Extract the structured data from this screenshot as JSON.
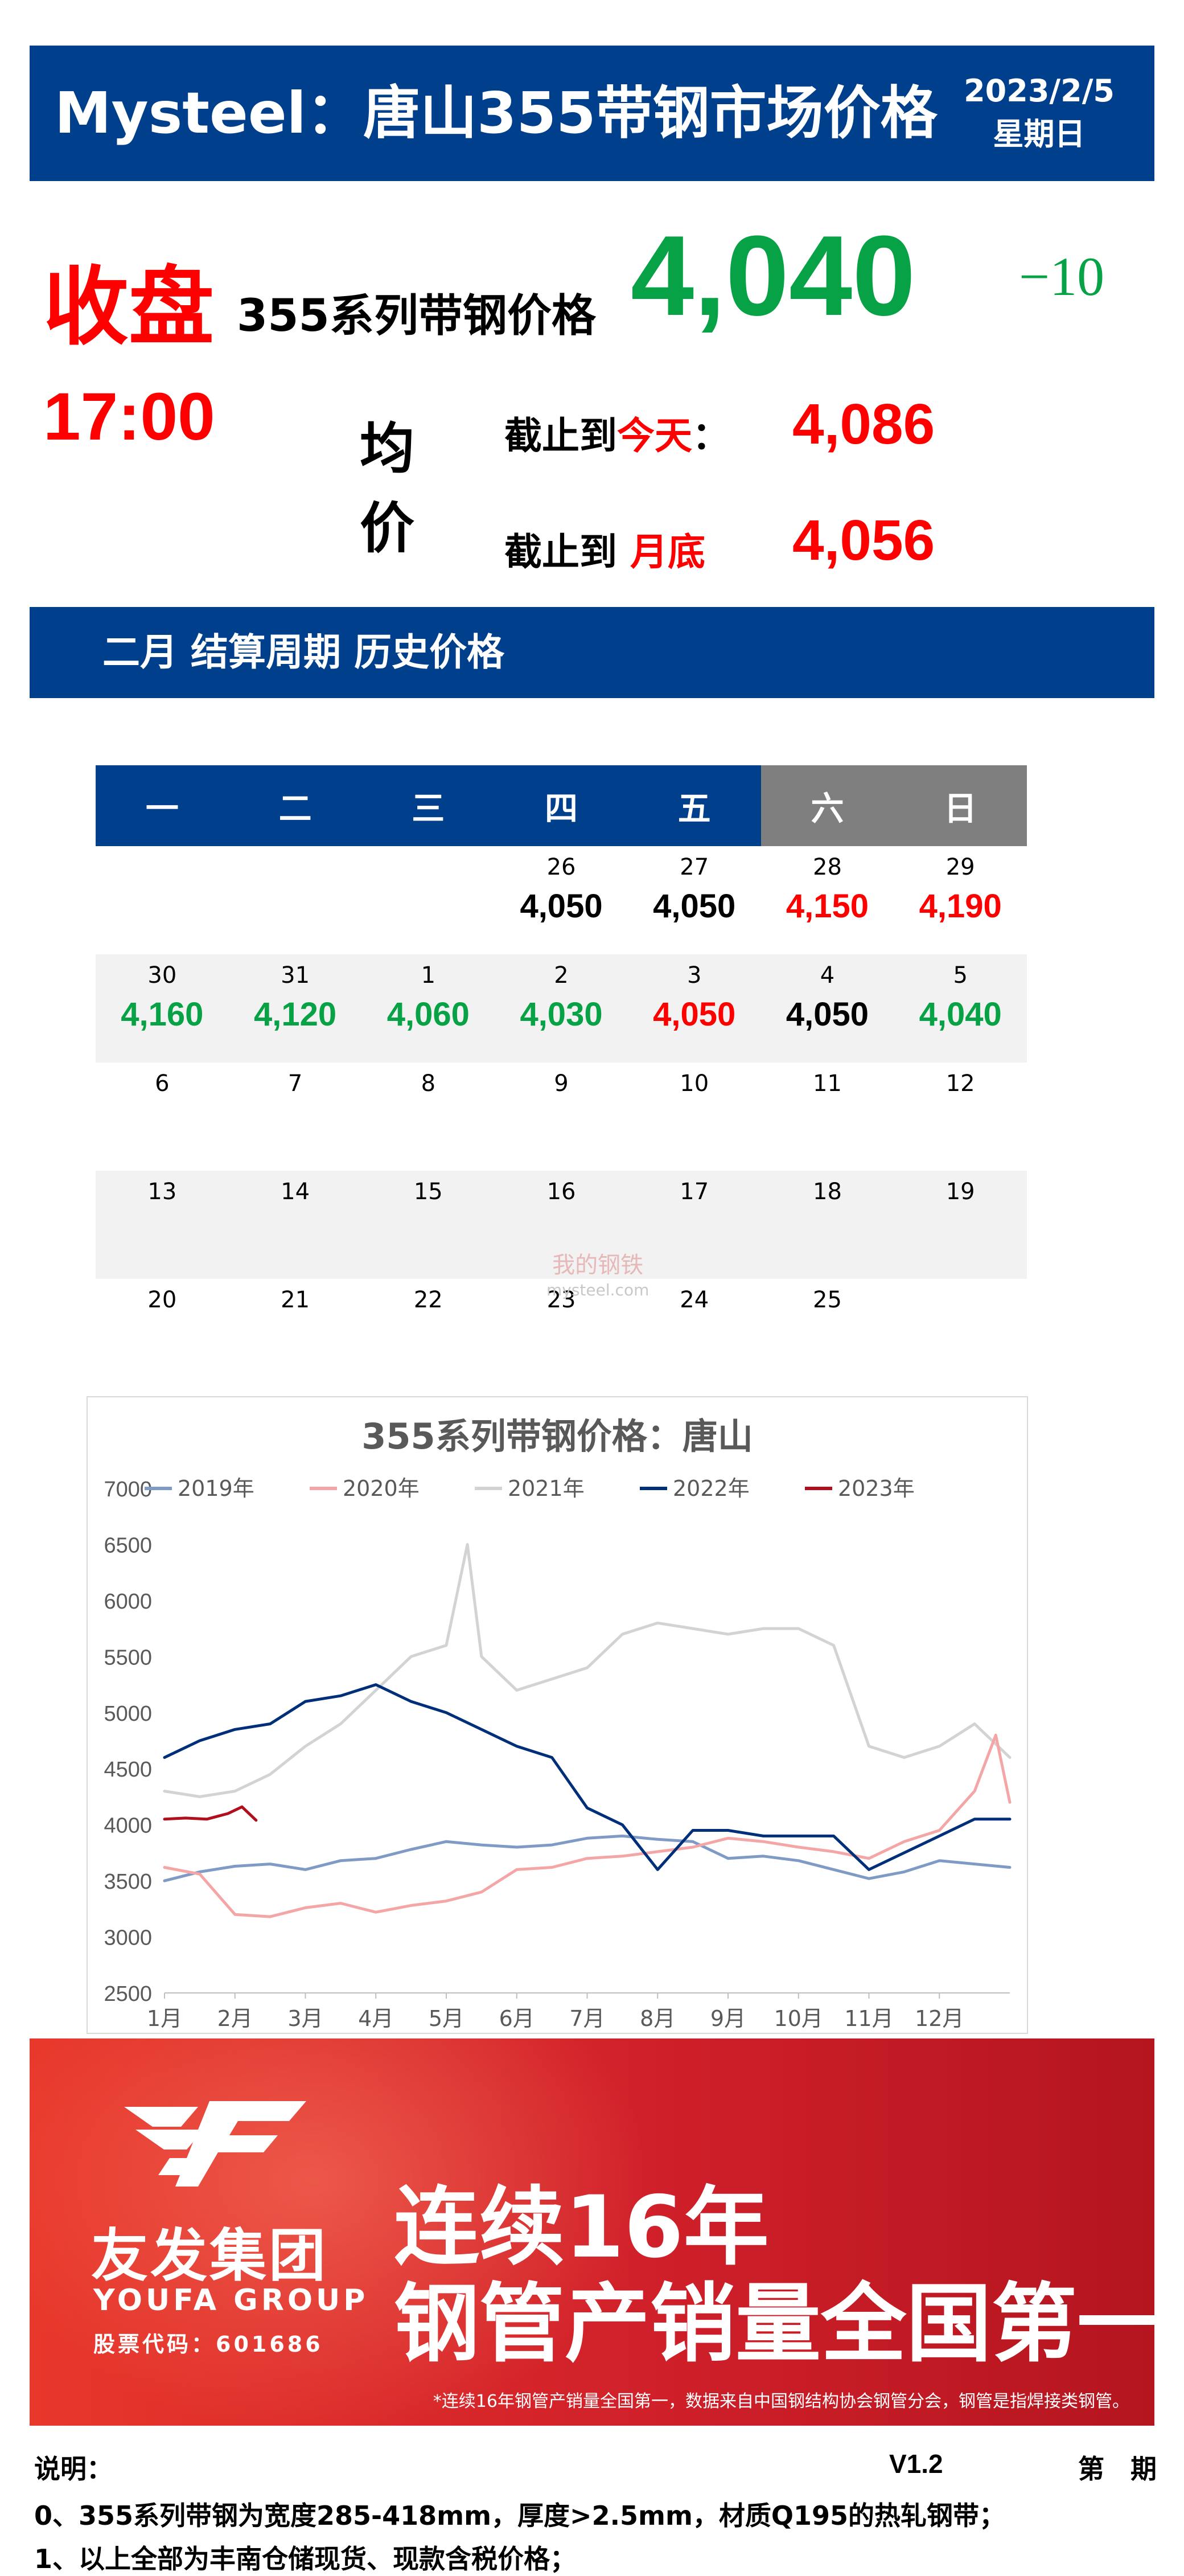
{
  "header": {
    "title": "Mysteel：唐山355带钢市场价格",
    "date": "2023/2/5",
    "weekday": "星期日"
  },
  "summary": {
    "close_label": "收盘",
    "series_label": "355系列带钢价格",
    "price": "4,040",
    "change": "−10",
    "time": "17:00",
    "avg_label_1": "均",
    "avg_label_2": "价",
    "today_prefix": "截止到",
    "today_word": "今天",
    "today_colon": "：",
    "today_value": "4,086",
    "month_prefix": "截止到",
    "month_word": "月底",
    "month_value": "4,056"
  },
  "section": {
    "title": "二月 结算周期 历史价格"
  },
  "calendar": {
    "weekdays": [
      "一",
      "二",
      "三",
      "四",
      "五",
      "六",
      "日"
    ],
    "weeks": [
      [
        {
          "day": "",
          "price": "",
          "color": "black"
        },
        {
          "day": "",
          "price": "",
          "color": "black"
        },
        {
          "day": "",
          "price": "",
          "color": "black"
        },
        {
          "day": "26",
          "price": "4,050",
          "color": "black"
        },
        {
          "day": "27",
          "price": "4,050",
          "color": "black"
        },
        {
          "day": "28",
          "price": "4,150",
          "color": "red"
        },
        {
          "day": "29",
          "price": "4,190",
          "color": "red"
        }
      ],
      [
        {
          "day": "30",
          "price": "4,160",
          "color": "green"
        },
        {
          "day": "31",
          "price": "4,120",
          "color": "green"
        },
        {
          "day": "1",
          "price": "4,060",
          "color": "green"
        },
        {
          "day": "2",
          "price": "4,030",
          "color": "green"
        },
        {
          "day": "3",
          "price": "4,050",
          "color": "red"
        },
        {
          "day": "4",
          "price": "4,050",
          "color": "black"
        },
        {
          "day": "5",
          "price": "4,040",
          "color": "green"
        }
      ],
      [
        {
          "day": "6",
          "price": "",
          "color": "black"
        },
        {
          "day": "7",
          "price": "",
          "color": "black"
        },
        {
          "day": "8",
          "price": "",
          "color": "black"
        },
        {
          "day": "9",
          "price": "",
          "color": "black"
        },
        {
          "day": "10",
          "price": "",
          "color": "black"
        },
        {
          "day": "11",
          "price": "",
          "color": "black"
        },
        {
          "day": "12",
          "price": "",
          "color": "black"
        }
      ],
      [
        {
          "day": "13",
          "price": "",
          "color": "black"
        },
        {
          "day": "14",
          "price": "",
          "color": "black"
        },
        {
          "day": "15",
          "price": "",
          "color": "black"
        },
        {
          "day": "16",
          "price": "",
          "color": "black"
        },
        {
          "day": "17",
          "price": "",
          "color": "black"
        },
        {
          "day": "18",
          "price": "",
          "color": "black"
        },
        {
          "day": "19",
          "price": "",
          "color": "black"
        }
      ],
      [
        {
          "day": "20",
          "price": "",
          "color": "black"
        },
        {
          "day": "21",
          "price": "",
          "color": "black"
        },
        {
          "day": "22",
          "price": "",
          "color": "black"
        },
        {
          "day": "23",
          "price": "",
          "color": "black"
        },
        {
          "day": "24",
          "price": "",
          "color": "black"
        },
        {
          "day": "25",
          "price": "",
          "color": "black"
        },
        {
          "day": "",
          "price": "",
          "color": "black"
        }
      ]
    ]
  },
  "watermark": {
    "text": "我的钢铁",
    "sub": "mysteel.com"
  },
  "chart_data": {
    "type": "line",
    "title": "355系列带钢价格：唐山",
    "xlabel": "",
    "ylabel": "",
    "ylim": [
      2500,
      7000
    ],
    "yticks": [
      2500,
      3000,
      3500,
      4000,
      4500,
      5000,
      5500,
      6000,
      6500,
      7000
    ],
    "x_categories": [
      "1月",
      "2月",
      "3月",
      "4月",
      "5月",
      "6月",
      "7月",
      "8月",
      "9月",
      "10月",
      "11月",
      "12月"
    ],
    "legend_position": "top",
    "grid": false,
    "series": [
      {
        "name": "2019年",
        "color": "#7F9BC5",
        "x": [
          1,
          1.5,
          2,
          2.5,
          3,
          3.5,
          4,
          4.5,
          5,
          5.5,
          6,
          6.5,
          7,
          7.5,
          8,
          8.5,
          9,
          9.5,
          10,
          10.5,
          11,
          11.5,
          12,
          12.5,
          13
        ],
        "y": [
          3500,
          3580,
          3630,
          3650,
          3600,
          3680,
          3700,
          3780,
          3850,
          3820,
          3800,
          3820,
          3880,
          3900,
          3870,
          3850,
          3700,
          3720,
          3680,
          3600,
          3520,
          3580,
          3680,
          3650,
          3620
        ]
      },
      {
        "name": "2020年",
        "color": "#F4A6A6",
        "x": [
          1,
          1.5,
          2,
          2.5,
          3,
          3.5,
          4,
          4.5,
          5,
          5.5,
          6,
          6.5,
          7,
          7.5,
          8,
          8.5,
          9,
          9.5,
          10,
          10.5,
          11,
          11.5,
          12,
          12.5,
          12.8,
          13
        ],
        "y": [
          3620,
          3560,
          3200,
          3180,
          3260,
          3300,
          3220,
          3280,
          3320,
          3400,
          3600,
          3620,
          3700,
          3720,
          3760,
          3800,
          3880,
          3850,
          3800,
          3760,
          3700,
          3850,
          3950,
          4300,
          4800,
          4200
        ]
      },
      {
        "name": "2021年",
        "color": "#D3D3D3",
        "x": [
          1,
          1.5,
          2,
          2.5,
          3,
          3.5,
          4,
          4.5,
          5,
          5.3,
          5.5,
          6,
          6.5,
          7,
          7.5,
          8,
          8.5,
          9,
          9.5,
          10,
          10.5,
          11,
          11.5,
          12,
          12.5,
          13
        ],
        "y": [
          4300,
          4250,
          4300,
          4450,
          4700,
          4900,
          5200,
          5500,
          5600,
          6500,
          5500,
          5200,
          5300,
          5400,
          5700,
          5800,
          5750,
          5700,
          5750,
          5750,
          5600,
          4700,
          4600,
          4700,
          4900,
          4600
        ]
      },
      {
        "name": "2022年",
        "color": "#002F7A",
        "x": [
          1,
          1.5,
          2,
          2.5,
          3,
          3.5,
          4,
          4.5,
          5,
          5.5,
          6,
          6.5,
          7,
          7.5,
          8,
          8.5,
          9,
          9.5,
          10,
          10.5,
          11,
          11.5,
          12,
          12.5,
          13
        ],
        "y": [
          4600,
          4750,
          4850,
          4900,
          5100,
          5150,
          5250,
          5100,
          5000,
          4850,
          4700,
          4600,
          4150,
          4000,
          3600,
          3950,
          3950,
          3900,
          3900,
          3900,
          3600,
          3750,
          3900,
          4050,
          4050
        ]
      },
      {
        "name": "2023年",
        "color": "#B10F1E",
        "x": [
          1,
          1.3,
          1.6,
          1.9,
          2.1,
          2.3
        ],
        "y": [
          4050,
          4060,
          4050,
          4100,
          4160,
          4040
        ]
      }
    ]
  },
  "banner": {
    "logo_cn": "友发集团",
    "logo_en": "YOUFA GROUP",
    "stock_code": "股票代码：601686",
    "slogan_line1": "连续16年",
    "slogan_line2": "钢管产销量全国第一",
    "footnote": "*连续16年钢管产销量全国第一，数据来自中国钢结构协会钢管分会，钢管是指焊接类钢管。"
  },
  "footer": {
    "notes_label": "说明：",
    "version": "V1.2",
    "period": "第　期",
    "note0": "0、355系列带钢为宽度285-418mm，厚度>2.5mm，材质Q195的热轧钢带；",
    "note1": "1、以上全部为丰南仓储现货、现款含税价格；"
  }
}
